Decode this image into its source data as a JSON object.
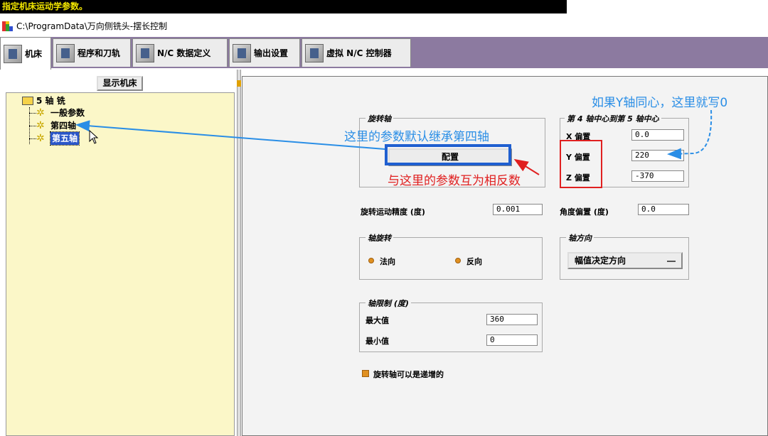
{
  "window": {
    "title": "指定机床运动学参数。",
    "path": "C:\\ProgramData\\万向侧铣头-摆长控制"
  },
  "tabs": [
    {
      "label": "机床",
      "icon": "machine-icon"
    },
    {
      "label": "程序和刀轨",
      "icon": "toolpath-icon"
    },
    {
      "label": "N/C 数据定义",
      "icon": "nc-data-icon"
    },
    {
      "label": "输出设置",
      "icon": "printer-icon"
    },
    {
      "label": "虚拟 N/C 控制器",
      "icon": "controller-icon"
    }
  ],
  "left": {
    "show_machine_button": "显示机床",
    "tree": {
      "root": "5 轴 铣",
      "items": [
        "一般参数",
        "第四轴",
        "第五轴"
      ]
    }
  },
  "panel": {
    "rotary_axis": {
      "title": "旋转轴",
      "config_button": "配置"
    },
    "center_offset": {
      "title": "第 4 轴中心到第 5 轴中心",
      "x_label": "X 偏置",
      "x_value": "0.0",
      "y_label": "Y 偏置",
      "y_value": "220",
      "z_label": "Z 偏置",
      "z_value": "-370"
    },
    "resolution_label": "旋转运动精度 (度)",
    "resolution_value": "0.001",
    "angle_offset_label": "角度偏置 (度)",
    "angle_offset_value": "0.0",
    "axis_rotation": {
      "title": "轴旋转",
      "normal": "法向",
      "reverse": "反向"
    },
    "axis_direction": {
      "title": "轴方向",
      "selected": "幅值决定方向"
    },
    "axis_limits": {
      "title": "轴限制 (度)",
      "max_label": "最大值",
      "max_value": "360",
      "min_label": "最小值",
      "min_value": "0"
    },
    "incremental_label": "旋转轴可以是递增的"
  },
  "annotations": {
    "inherit_note": "这里的参数默认继承第四轴",
    "opposite_note": "与这里的参数互为相反数",
    "y_note": "如果Y轴同心，这里就写0"
  },
  "colors": {
    "title_bg": "#000000",
    "title_fg": "#f2e600",
    "tab_strip": "#8c7aa0",
    "tree_bg": "#fbf7c8",
    "annotation_blue": "#2a8ee6",
    "annotation_red": "#e02020"
  }
}
